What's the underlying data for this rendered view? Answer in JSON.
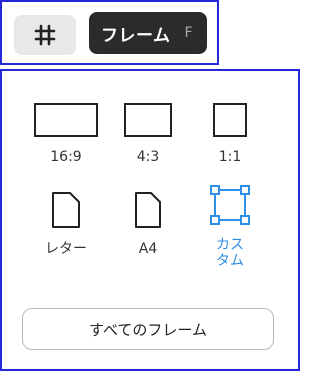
{
  "toolbar": {
    "frame_tool_icon": "hash-icon",
    "tooltip_label": "フレーム",
    "tooltip_shortcut": "F"
  },
  "panel": {
    "options": [
      {
        "label": "16:9",
        "icon": "rectangle-16-9-icon"
      },
      {
        "label": "4:3",
        "icon": "rectangle-4-3-icon"
      },
      {
        "label": "1:1",
        "icon": "square-icon"
      },
      {
        "label": "レター",
        "icon": "page-letter-icon"
      },
      {
        "label": "A4",
        "icon": "page-a4-icon"
      },
      {
        "label": "カスタム",
        "icon": "custom-frame-icon"
      }
    ],
    "all_frames_label": "すべてのフレーム"
  },
  "colors": {
    "accent": "#2f8ee5",
    "border_highlight": "#2428d9",
    "tooltip_bg": "#2b2b2b"
  }
}
